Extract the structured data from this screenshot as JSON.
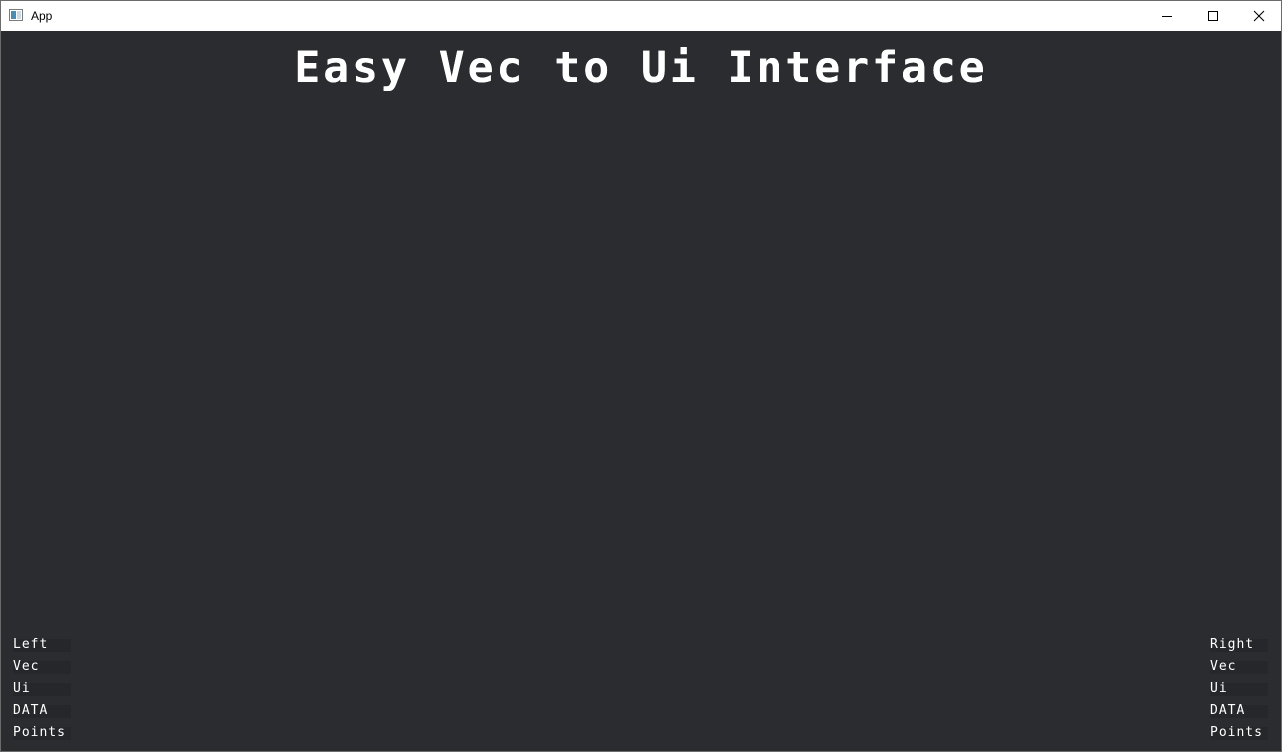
{
  "window": {
    "title": "App",
    "controls": {
      "minimize_icon": "minimize-icon",
      "maximize_icon": "maximize-icon",
      "close_icon": "close-icon"
    }
  },
  "canvas": {
    "background": "#2a2c30",
    "headline": "Easy Vec to Ui Interface"
  },
  "left_panel": {
    "items": [
      {
        "label": "Left"
      },
      {
        "label": "Vec"
      },
      {
        "label": "Ui"
      },
      {
        "label": "DATA"
      },
      {
        "label": "Points"
      }
    ]
  },
  "right_panel": {
    "items": [
      {
        "label": "Right"
      },
      {
        "label": "Vec"
      },
      {
        "label": "Ui"
      },
      {
        "label": "DATA"
      },
      {
        "label": "Points"
      }
    ]
  }
}
